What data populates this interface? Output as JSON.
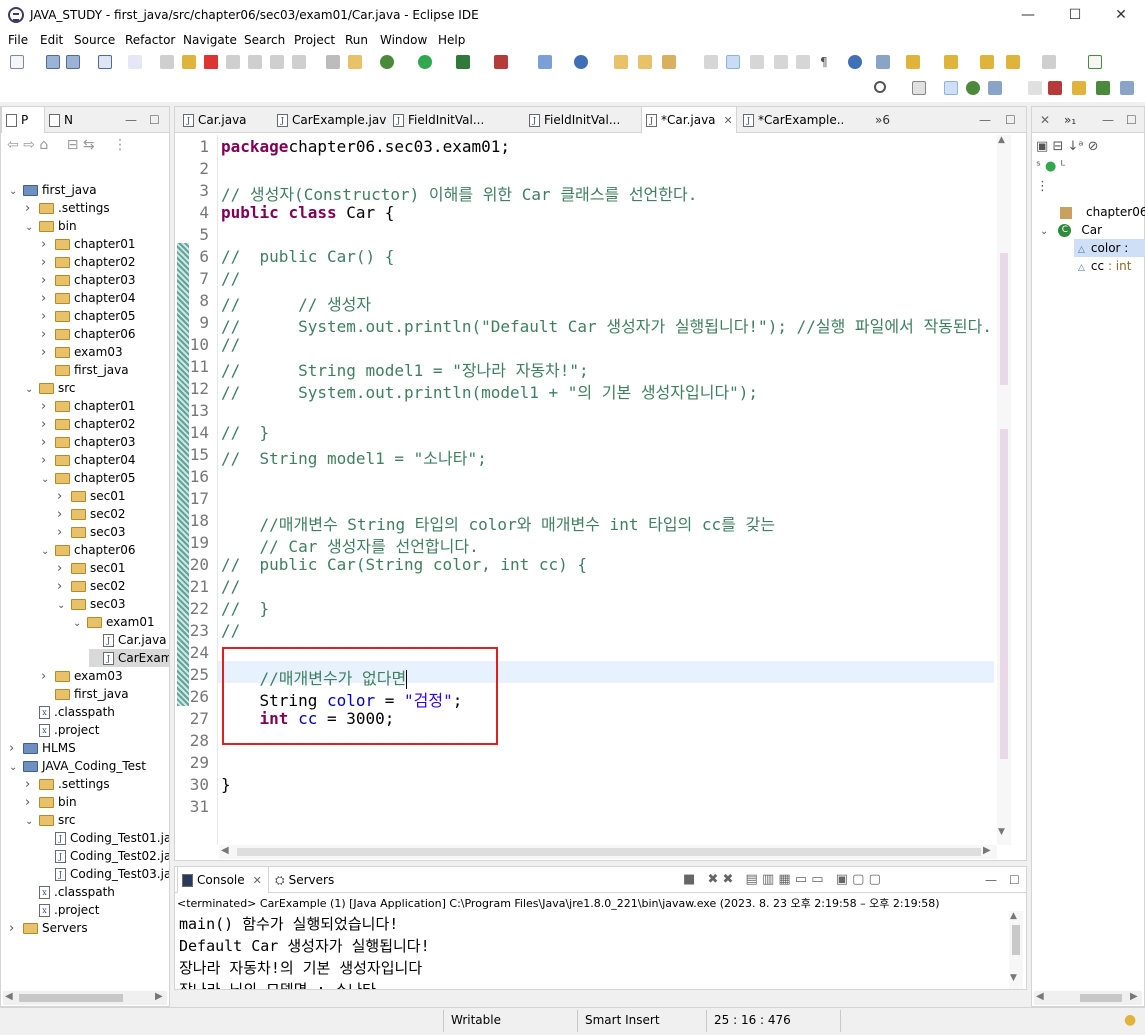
{
  "window": {
    "title": "JAVA_STUDY - first_java/src/chapter06/sec03/exam01/Car.java - Eclipse IDE",
    "minimize": "—",
    "maximize": "☐",
    "close": "✕"
  },
  "menu": [
    "File",
    "Edit",
    "Source",
    "Refactor",
    "Navigate",
    "Search",
    "Project",
    "Run",
    "Window",
    "Help"
  ],
  "left_tabs": [
    "P",
    "N"
  ],
  "tree": [
    {
      "label": "first_java",
      "icon": "project-icon",
      "depth": 0,
      "open": true
    },
    {
      "label": ".settings",
      "icon": "folder-icon",
      "depth": 1,
      "open": false
    },
    {
      "label": "bin",
      "icon": "folder-icon",
      "depth": 1,
      "open": true
    },
    {
      "label": "chapter01",
      "icon": "folder-icon",
      "depth": 2,
      "open": false
    },
    {
      "label": "chapter02",
      "icon": "folder-icon",
      "depth": 2,
      "open": false
    },
    {
      "label": "chapter03",
      "icon": "folder-icon",
      "depth": 2,
      "open": false
    },
    {
      "label": "chapter04",
      "icon": "folder-icon",
      "depth": 2,
      "open": false
    },
    {
      "label": "chapter05",
      "icon": "folder-icon",
      "depth": 2,
      "open": false
    },
    {
      "label": "chapter06",
      "icon": "folder-icon",
      "depth": 2,
      "open": false
    },
    {
      "label": "exam03",
      "icon": "folder-icon",
      "depth": 2,
      "open": false
    },
    {
      "label": "first_java",
      "icon": "folder-icon",
      "depth": 2,
      "open": null
    },
    {
      "label": "src",
      "icon": "folder-icon",
      "depth": 1,
      "open": true
    },
    {
      "label": "chapter01",
      "icon": "folder-icon",
      "depth": 2,
      "open": false
    },
    {
      "label": "chapter02",
      "icon": "folder-icon",
      "depth": 2,
      "open": false
    },
    {
      "label": "chapter03",
      "icon": "folder-icon",
      "depth": 2,
      "open": false
    },
    {
      "label": "chapter04",
      "icon": "folder-icon",
      "depth": 2,
      "open": false
    },
    {
      "label": "chapter05",
      "icon": "folder-icon",
      "depth": 2,
      "open": true
    },
    {
      "label": "sec01",
      "icon": "folder-icon",
      "depth": 3,
      "open": false
    },
    {
      "label": "sec02",
      "icon": "folder-icon",
      "depth": 3,
      "open": false
    },
    {
      "label": "sec03",
      "icon": "folder-icon",
      "depth": 3,
      "open": false
    },
    {
      "label": "chapter06",
      "icon": "folder-icon",
      "depth": 2,
      "open": true
    },
    {
      "label": "sec01",
      "icon": "folder-icon",
      "depth": 3,
      "open": false
    },
    {
      "label": "sec02",
      "icon": "folder-icon",
      "depth": 3,
      "open": false
    },
    {
      "label": "sec03",
      "icon": "folder-icon",
      "depth": 3,
      "open": true
    },
    {
      "label": "exam01",
      "icon": "folder-icon",
      "depth": 4,
      "open": true
    },
    {
      "label": "Car.java",
      "icon": "java-file-icon",
      "depth": 5,
      "open": null
    },
    {
      "label": "CarExam",
      "icon": "java-file-icon",
      "depth": 5,
      "open": null,
      "selected": true
    },
    {
      "label": "exam03",
      "icon": "folder-icon",
      "depth": 2,
      "open": false
    },
    {
      "label": "first_java",
      "icon": "folder-icon",
      "depth": 2,
      "open": null
    },
    {
      "label": ".classpath",
      "icon": "xml-file-icon",
      "depth": 1,
      "open": null
    },
    {
      "label": ".project",
      "icon": "xml-file-icon",
      "depth": 1,
      "open": null
    },
    {
      "label": "HLMS",
      "icon": "project-icon",
      "depth": 0,
      "open": false
    },
    {
      "label": "JAVA_Coding_Test",
      "icon": "project-icon",
      "depth": 0,
      "open": true
    },
    {
      "label": ".settings",
      "icon": "folder-icon",
      "depth": 1,
      "open": false
    },
    {
      "label": "bin",
      "icon": "folder-icon",
      "depth": 1,
      "open": false
    },
    {
      "label": "src",
      "icon": "folder-icon",
      "depth": 1,
      "open": true
    },
    {
      "label": "Coding_Test01.ja",
      "icon": "java-file-icon",
      "depth": 2,
      "open": null
    },
    {
      "label": "Coding_Test02.ja",
      "icon": "java-file-icon",
      "depth": 2,
      "open": null
    },
    {
      "label": "Coding_Test03.ja",
      "icon": "java-file-icon",
      "depth": 2,
      "open": null
    },
    {
      "label": ".classpath",
      "icon": "xml-file-icon",
      "depth": 1,
      "open": null
    },
    {
      "label": ".project",
      "icon": "xml-file-icon",
      "depth": 1,
      "open": null
    },
    {
      "label": "Servers",
      "icon": "folder-icon",
      "depth": 0,
      "open": false
    }
  ],
  "editor_tabs": [
    {
      "label": "Car.java",
      "active": false
    },
    {
      "label": "CarExample.java",
      "active": false
    },
    {
      "label": "FieldInitVal...",
      "active": false
    },
    {
      "label": "FieldInitVal...",
      "active": false
    },
    {
      "label": "*Car.java",
      "active": true,
      "close": "✕"
    },
    {
      "label": "*CarExample....",
      "active": false
    }
  ],
  "editor_overflow": "»6",
  "code_lines": [
    [
      [
        "kw",
        "package"
      ],
      [
        "",
        "chapter06.sec03.exam01;"
      ]
    ],
    [],
    [
      [
        "cm",
        "// 생성자(Constructor) 이해를 위한 Car 클래스를 선언한다."
      ]
    ],
    [
      [
        "kw",
        "public"
      ],
      [
        "",
        " "
      ],
      [
        "kw",
        "class"
      ],
      [
        "",
        " Car {"
      ]
    ],
    [],
    [
      [
        "cm",
        "//  public Car() {"
      ]
    ],
    [
      [
        "cm",
        "//"
      ]
    ],
    [
      [
        "cm",
        "//      // 생성자"
      ]
    ],
    [
      [
        "cm",
        "//      System.out.println(\"Default Car 생성자가 실행됩니다!\"); //실행 파일에서 작동된다."
      ]
    ],
    [
      [
        "cm",
        "//"
      ]
    ],
    [
      [
        "cm",
        "//      String model1 = \"장나라 자동차!\";"
      ]
    ],
    [
      [
        "cm",
        "//      System.out.println(model1 + \"의 기본 생성자입니다\");"
      ]
    ],
    [],
    [
      [
        "cm",
        "//  }"
      ]
    ],
    [
      [
        "cm",
        "//  String model1 = \"소나타\";"
      ]
    ],
    [],
    [],
    [
      [
        "cm",
        "    //매개변수 String 타입의 color와 매개변수 int 타입의 cc를 갖는"
      ]
    ],
    [
      [
        "cm",
        "    // Car 생성자를 선언합니다."
      ]
    ],
    [
      [
        "cm",
        "//  public Car(String color, int cc) {"
      ]
    ],
    [
      [
        "cm",
        "//"
      ]
    ],
    [
      [
        "cm",
        "//  }"
      ]
    ],
    [
      [
        "cm",
        "//"
      ]
    ],
    [],
    [
      [
        "cm",
        "    //매개변수가 없다면"
      ]
    ],
    [
      [
        "",
        "    String "
      ],
      [
        "fld",
        "color"
      ],
      [
        "",
        " = "
      ],
      [
        "st",
        "\"검정\""
      ],
      [
        "",
        ";"
      ]
    ],
    [
      [
        "",
        "    "
      ],
      [
        "kw",
        "int"
      ],
      [
        "",
        " "
      ],
      [
        "fld",
        "cc"
      ],
      [
        "",
        " = 3000;"
      ]
    ],
    [],
    [],
    [
      [
        "",
        "}"
      ]
    ],
    []
  ],
  "outline": {
    "package": "chapter06",
    "class": "Car",
    "fields": [
      {
        "name": "color",
        "type": " :"
      },
      {
        "name": "cc",
        "type": " : int"
      }
    ]
  },
  "console": {
    "tabs": [
      "Console",
      "Servers"
    ],
    "header": "<terminated> CarExample (1) [Java Application] C:\\Program Files\\Java\\jre1.8.0_221\\bin\\javaw.exe  (2023. 8. 23 오후 2:19:58 – 오후 2:19:58)",
    "lines": [
      "main() 함수가 실행되었습니다!",
      "Default Car 생성자가 실행됩니다!",
      "장나라 자동차!의 기본 생성자입니다",
      "장나라 님의 모델명 : 소나타"
    ]
  },
  "status": {
    "mode": "Writable",
    "insert": "Smart Insert",
    "position": "25 : 16 : 476"
  },
  "colors": {
    "keyword": "#7f0055",
    "comment": "#3f7f5f",
    "string": "#2a00ff",
    "field": "#0000c0",
    "highlight": "#e8f2fe",
    "annotation_box": "#e02020"
  }
}
